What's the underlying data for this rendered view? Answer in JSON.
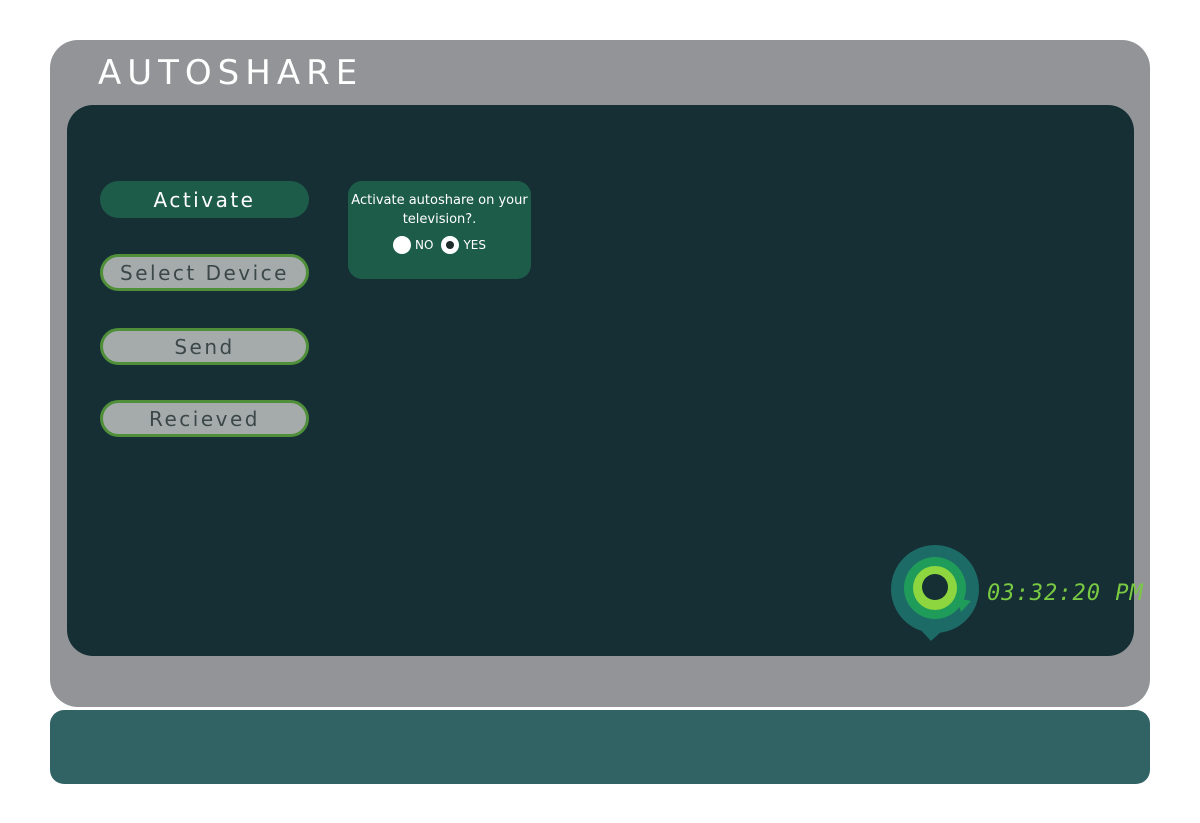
{
  "app": {
    "title": "AUTOSHARE"
  },
  "nav": {
    "items": [
      {
        "label": "Activate",
        "state": "active"
      },
      {
        "label": "Select Device",
        "state": "inactive"
      },
      {
        "label": "Send",
        "state": "inactive"
      },
      {
        "label": "Recieved",
        "state": "inactive"
      }
    ]
  },
  "dialog": {
    "question": "Activate autoshare on your television?.",
    "options": [
      {
        "label": "NO",
        "selected": false
      },
      {
        "label": "YES",
        "selected": true
      }
    ]
  },
  "status": {
    "clock": "03:32:20 PM",
    "logo_icon": "autoshare-logo-icon"
  },
  "colors": {
    "frame": "#929497",
    "screen": "#152f34",
    "accent_green": "#1e5c4a",
    "button_border": "#4f8f3a",
    "clock_text": "#7ac943",
    "base": "#316365"
  }
}
